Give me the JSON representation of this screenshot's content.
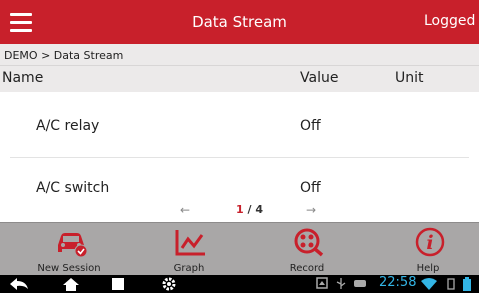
{
  "header": {
    "title": "Data Stream",
    "logged": "Logged In"
  },
  "breadcrumb": "DEMO > Data Stream",
  "columns": {
    "name": "Name",
    "value": "Value",
    "unit": "Unit"
  },
  "rows": [
    {
      "name": "A/C relay",
      "value": "Off",
      "unit": ""
    },
    {
      "name": "A/C switch",
      "value": "Off",
      "unit": ""
    }
  ],
  "pager": {
    "current": "1",
    "total": "/ 4",
    "prev_icon": "arrow-left-icon",
    "next_icon": "arrow-right-icon"
  },
  "toolbar": {
    "items": [
      {
        "label": "New Session",
        "icon": "car-check-icon"
      },
      {
        "label": "Graph",
        "icon": "line-graph-icon"
      },
      {
        "label": "Record",
        "icon": "record-search-icon"
      },
      {
        "label": "Help",
        "icon": "info-icon"
      }
    ]
  },
  "system_bar": {
    "time": "22:58",
    "icons": [
      "back-icon",
      "home-icon",
      "recent-apps-icon",
      "settings-icon",
      "screenshot-icon",
      "usb-icon",
      "storage-icon",
      "wifi-icon",
      "battery-icon"
    ]
  },
  "colors": {
    "brand": "#c8202b",
    "toolbar": "#a9a7a7",
    "clock": "#33b5e5"
  }
}
